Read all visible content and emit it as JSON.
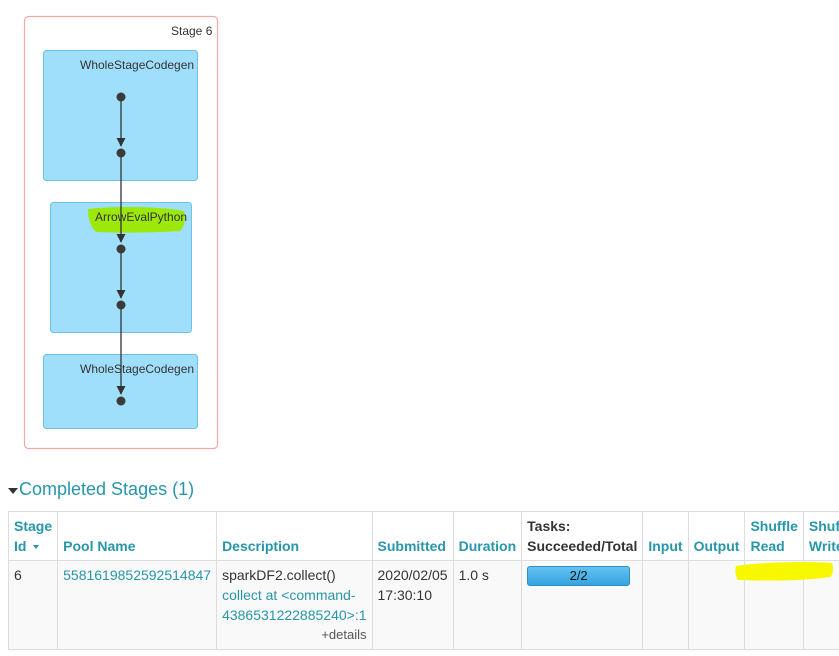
{
  "dag": {
    "stage_label": "Stage 6",
    "clusters": [
      {
        "label": "WholeStageCodegen"
      },
      {
        "label": "ArrowEvalPython"
      },
      {
        "label": "WholeStageCodegen"
      }
    ]
  },
  "completed_stages": {
    "title": "Completed Stages (1)",
    "columns": {
      "stage_id_line1": "Stage",
      "stage_id_line2": "Id",
      "pool_name": "Pool Name",
      "description": "Description",
      "submitted": "Submitted",
      "duration": "Duration",
      "tasks_line1": "Tasks:",
      "tasks_line2": "Succeeded/Total",
      "input": "Input",
      "output": "Output",
      "shuffle_read_line1": "Shuffle",
      "shuffle_read_line2": "Read",
      "shuffle_write_line1": "Shuffle",
      "shuffle_write_line2": "Write"
    },
    "rows": [
      {
        "stage_id": "6",
        "pool_name": "5581619852592514847",
        "description_main": "sparkDF2.collect()",
        "description_link_1": "collect at <command-",
        "description_link_2": "4386531222885240>:1",
        "details": "+details",
        "submitted_1": "2020/02/05",
        "submitted_2": "17:30:10",
        "duration": "1.0 s",
        "tasks": "2/2",
        "tasks_fraction": 1.0,
        "input": "",
        "output": "",
        "shuffle_read": "",
        "shuffle_write": ""
      }
    ]
  },
  "colors": {
    "link": "#2796a9",
    "cluster_fill": "#a0dffc",
    "stage_border": "#f4a7a7",
    "highlight_green": "#9be80a",
    "highlight_yellow": "#f7f700"
  }
}
